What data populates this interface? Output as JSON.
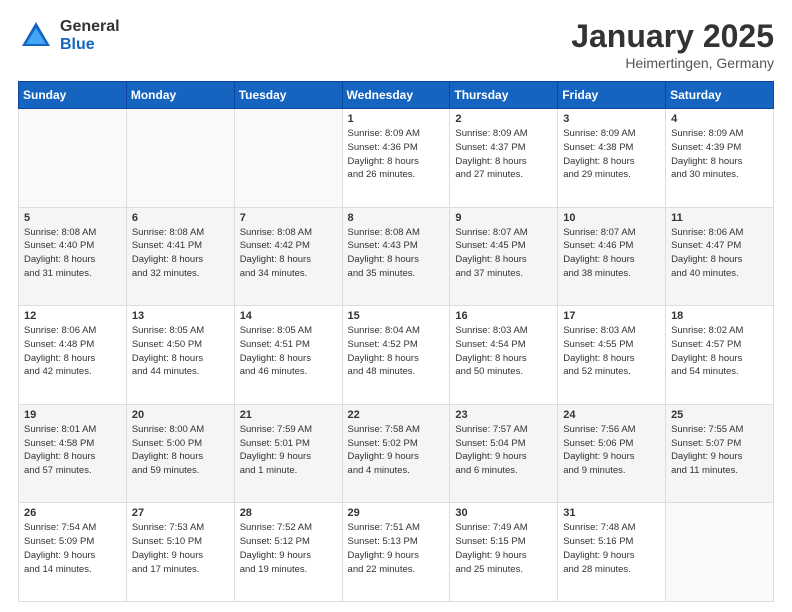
{
  "header": {
    "logo_general": "General",
    "logo_blue": "Blue",
    "month_title": "January 2025",
    "location": "Heimertingen, Germany"
  },
  "weekdays": [
    "Sunday",
    "Monday",
    "Tuesday",
    "Wednesday",
    "Thursday",
    "Friday",
    "Saturday"
  ],
  "weeks": [
    {
      "bg": "white",
      "days": [
        {
          "num": "",
          "info": ""
        },
        {
          "num": "",
          "info": ""
        },
        {
          "num": "",
          "info": ""
        },
        {
          "num": "1",
          "info": "Sunrise: 8:09 AM\nSunset: 4:36 PM\nDaylight: 8 hours\nand 26 minutes."
        },
        {
          "num": "2",
          "info": "Sunrise: 8:09 AM\nSunset: 4:37 PM\nDaylight: 8 hours\nand 27 minutes."
        },
        {
          "num": "3",
          "info": "Sunrise: 8:09 AM\nSunset: 4:38 PM\nDaylight: 8 hours\nand 29 minutes."
        },
        {
          "num": "4",
          "info": "Sunrise: 8:09 AM\nSunset: 4:39 PM\nDaylight: 8 hours\nand 30 minutes."
        }
      ]
    },
    {
      "bg": "light",
      "days": [
        {
          "num": "5",
          "info": "Sunrise: 8:08 AM\nSunset: 4:40 PM\nDaylight: 8 hours\nand 31 minutes."
        },
        {
          "num": "6",
          "info": "Sunrise: 8:08 AM\nSunset: 4:41 PM\nDaylight: 8 hours\nand 32 minutes."
        },
        {
          "num": "7",
          "info": "Sunrise: 8:08 AM\nSunset: 4:42 PM\nDaylight: 8 hours\nand 34 minutes."
        },
        {
          "num": "8",
          "info": "Sunrise: 8:08 AM\nSunset: 4:43 PM\nDaylight: 8 hours\nand 35 minutes."
        },
        {
          "num": "9",
          "info": "Sunrise: 8:07 AM\nSunset: 4:45 PM\nDaylight: 8 hours\nand 37 minutes."
        },
        {
          "num": "10",
          "info": "Sunrise: 8:07 AM\nSunset: 4:46 PM\nDaylight: 8 hours\nand 38 minutes."
        },
        {
          "num": "11",
          "info": "Sunrise: 8:06 AM\nSunset: 4:47 PM\nDaylight: 8 hours\nand 40 minutes."
        }
      ]
    },
    {
      "bg": "white",
      "days": [
        {
          "num": "12",
          "info": "Sunrise: 8:06 AM\nSunset: 4:48 PM\nDaylight: 8 hours\nand 42 minutes."
        },
        {
          "num": "13",
          "info": "Sunrise: 8:05 AM\nSunset: 4:50 PM\nDaylight: 8 hours\nand 44 minutes."
        },
        {
          "num": "14",
          "info": "Sunrise: 8:05 AM\nSunset: 4:51 PM\nDaylight: 8 hours\nand 46 minutes."
        },
        {
          "num": "15",
          "info": "Sunrise: 8:04 AM\nSunset: 4:52 PM\nDaylight: 8 hours\nand 48 minutes."
        },
        {
          "num": "16",
          "info": "Sunrise: 8:03 AM\nSunset: 4:54 PM\nDaylight: 8 hours\nand 50 minutes."
        },
        {
          "num": "17",
          "info": "Sunrise: 8:03 AM\nSunset: 4:55 PM\nDaylight: 8 hours\nand 52 minutes."
        },
        {
          "num": "18",
          "info": "Sunrise: 8:02 AM\nSunset: 4:57 PM\nDaylight: 8 hours\nand 54 minutes."
        }
      ]
    },
    {
      "bg": "light",
      "days": [
        {
          "num": "19",
          "info": "Sunrise: 8:01 AM\nSunset: 4:58 PM\nDaylight: 8 hours\nand 57 minutes."
        },
        {
          "num": "20",
          "info": "Sunrise: 8:00 AM\nSunset: 5:00 PM\nDaylight: 8 hours\nand 59 minutes."
        },
        {
          "num": "21",
          "info": "Sunrise: 7:59 AM\nSunset: 5:01 PM\nDaylight: 9 hours\nand 1 minute."
        },
        {
          "num": "22",
          "info": "Sunrise: 7:58 AM\nSunset: 5:02 PM\nDaylight: 9 hours\nand 4 minutes."
        },
        {
          "num": "23",
          "info": "Sunrise: 7:57 AM\nSunset: 5:04 PM\nDaylight: 9 hours\nand 6 minutes."
        },
        {
          "num": "24",
          "info": "Sunrise: 7:56 AM\nSunset: 5:06 PM\nDaylight: 9 hours\nand 9 minutes."
        },
        {
          "num": "25",
          "info": "Sunrise: 7:55 AM\nSunset: 5:07 PM\nDaylight: 9 hours\nand 11 minutes."
        }
      ]
    },
    {
      "bg": "white",
      "days": [
        {
          "num": "26",
          "info": "Sunrise: 7:54 AM\nSunset: 5:09 PM\nDaylight: 9 hours\nand 14 minutes."
        },
        {
          "num": "27",
          "info": "Sunrise: 7:53 AM\nSunset: 5:10 PM\nDaylight: 9 hours\nand 17 minutes."
        },
        {
          "num": "28",
          "info": "Sunrise: 7:52 AM\nSunset: 5:12 PM\nDaylight: 9 hours\nand 19 minutes."
        },
        {
          "num": "29",
          "info": "Sunrise: 7:51 AM\nSunset: 5:13 PM\nDaylight: 9 hours\nand 22 minutes."
        },
        {
          "num": "30",
          "info": "Sunrise: 7:49 AM\nSunset: 5:15 PM\nDaylight: 9 hours\nand 25 minutes."
        },
        {
          "num": "31",
          "info": "Sunrise: 7:48 AM\nSunset: 5:16 PM\nDaylight: 9 hours\nand 28 minutes."
        },
        {
          "num": "",
          "info": ""
        }
      ]
    }
  ]
}
